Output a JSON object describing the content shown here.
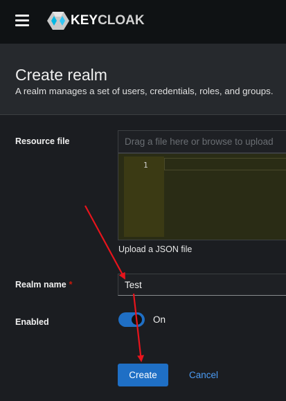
{
  "header": {
    "menu_icon": "hamburger-menu-icon",
    "logo_text_key": "KEY",
    "logo_text_cloak": "CLOAK"
  },
  "page": {
    "title": "Create realm",
    "subtitle": "A realm manages a set of users, credentials, roles, and groups."
  },
  "form": {
    "resource_file": {
      "label": "Resource file",
      "placeholder": "Drag a file here or browse to upload",
      "editor_line_number": "1",
      "helper_text": "Upload a JSON file"
    },
    "realm_name": {
      "label": "Realm name",
      "required_marker": "*",
      "value": "Test"
    },
    "enabled": {
      "label": "Enabled",
      "state_label": "On",
      "checked": true
    }
  },
  "actions": {
    "create_label": "Create",
    "cancel_label": "Cancel"
  },
  "colors": {
    "primary": "#1f6fc5",
    "link": "#4b9cf5",
    "annotation_arrow": "#e8141c",
    "required": "#c9190b"
  }
}
